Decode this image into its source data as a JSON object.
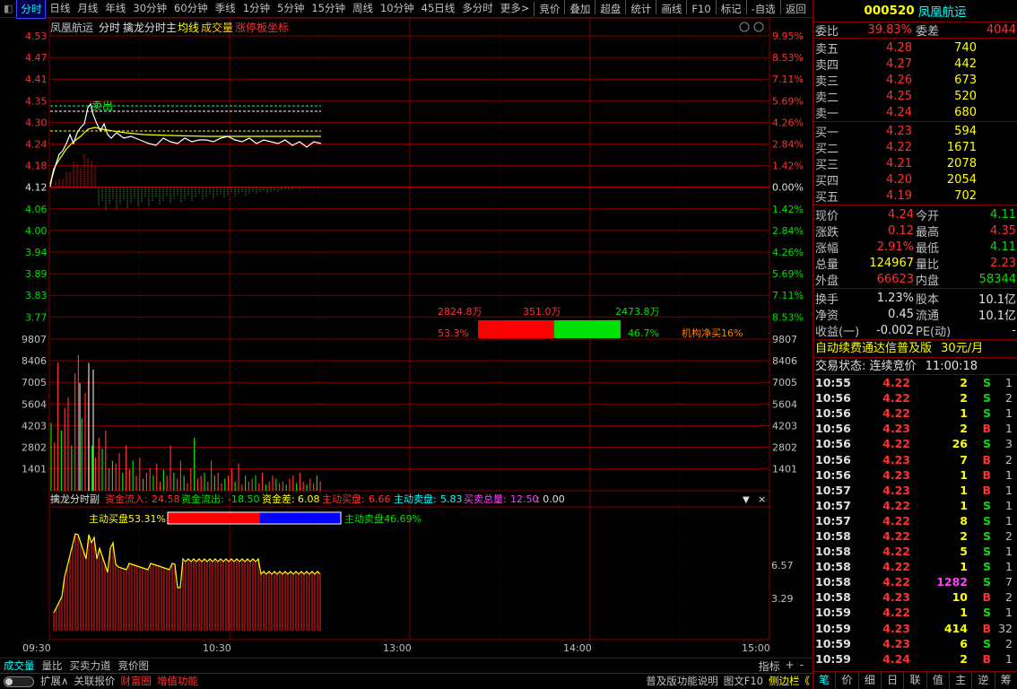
{
  "topbar": {
    "tabs": [
      "分时",
      "日线",
      "月线",
      "年线",
      "30分钟",
      "60分钟",
      "季线",
      "1分钟",
      "5分钟",
      "15分钟",
      "周线",
      "10分钟",
      "45日线",
      "多分时",
      "更多>"
    ],
    "active_index": 0,
    "right_tabs": [
      "竞价",
      "叠加",
      "超盘",
      "统计",
      "画线",
      "F10",
      "标记",
      "-自选",
      "返回"
    ]
  },
  "chart_header": {
    "stock_name": "凤凰航运",
    "mode": "分时",
    "indicator": "擒龙分时主",
    "avg_label": "均线",
    "vol_label": "成交量",
    "limit_label": "涨停板坐标"
  },
  "price_axis": {
    "left": [
      "4.53",
      "4.47",
      "4.41",
      "4.35",
      "4.30",
      "4.24",
      "4.18",
      "4.12",
      "4.06",
      "4.00",
      "3.94",
      "3.89",
      "3.83",
      "3.77"
    ],
    "right": [
      "9.95%",
      "8.53%",
      "7.11%",
      "5.69%",
      "4.26%",
      "2.84%",
      "1.42%",
      "0.00%",
      "1.42%",
      "2.84%",
      "4.26%",
      "5.69%",
      "7.11%",
      "8.53%"
    ]
  },
  "vol_axis": {
    "left": [
      "9807",
      "8406",
      "7005",
      "5604",
      "4203",
      "2802",
      "1401"
    ],
    "right": [
      "9807",
      "8406",
      "7005",
      "5604",
      "4203",
      "2802",
      "1401"
    ]
  },
  "time_axis": [
    "09:30",
    "10:30",
    "13:00",
    "14:00",
    "15:00"
  ],
  "annotation": {
    "label": "卖出"
  },
  "inst_panel": {
    "buy_amount": "2824.8万",
    "diff_amount": "351.0万",
    "sell_amount": "2473.8万",
    "buy_pct": "53.3%",
    "sell_pct": "46.7%",
    "net_label": "机构净买16%",
    "buy_share": 0.533
  },
  "sub_header": {
    "name": "擒龙分时副",
    "inflow_label": "资金流入:",
    "inflow": "24.58",
    "outflow_label": "资金流出:",
    "outflow": "-18.50",
    "diff_label": "资金差:",
    "diff": "6.08",
    "active_buy_label": "主动买盘:",
    "active_buy": "6.66",
    "active_sell_label": "主动卖盘:",
    "active_sell": "5.83",
    "total_label": "买卖总量:",
    "total": "12.50",
    "zero": ": 0.00",
    "buy_ratio_label": "主动买盘53.31%",
    "sell_ratio_label": "主动卖盘46.69%",
    "buy_ratio": 0.5331
  },
  "sub_axis": [
    "6.57",
    "3.29"
  ],
  "bottom_tabs": [
    "成交量",
    "量比",
    "买卖力道",
    "竞价图"
  ],
  "bottom_right": [
    "指标",
    "+",
    "-"
  ],
  "bottom_bar": {
    "expand": "扩展∧",
    "items": [
      "关联报价",
      "财富圈",
      "增值功能"
    ],
    "right": [
      "普及版功能说明",
      "图文F10",
      "侧边栏《"
    ]
  },
  "side": {
    "code": "000520",
    "name": "凤凰航运",
    "wei_bi_label": "委比",
    "wei_bi": "39.83%",
    "wei_cha_label": "委差",
    "wei_cha": "4044",
    "asks": [
      {
        "label": "卖五",
        "price": "4.28",
        "vol": "740"
      },
      {
        "label": "卖四",
        "price": "4.27",
        "vol": "442"
      },
      {
        "label": "卖三",
        "price": "4.26",
        "vol": "673"
      },
      {
        "label": "卖二",
        "price": "4.25",
        "vol": "520"
      },
      {
        "label": "卖一",
        "price": "4.24",
        "vol": "680"
      }
    ],
    "bids": [
      {
        "label": "买一",
        "price": "4.23",
        "vol": "594"
      },
      {
        "label": "买二",
        "price": "4.22",
        "vol": "1671"
      },
      {
        "label": "买三",
        "price": "4.21",
        "vol": "2078"
      },
      {
        "label": "买四",
        "price": "4.20",
        "vol": "2054"
      },
      {
        "label": "买五",
        "price": "4.19",
        "vol": "702"
      }
    ],
    "quote1": [
      {
        "k": "现价",
        "v": "4.24",
        "vc": "red",
        "k2": "今开",
        "v2": "4.11",
        "v2c": "green"
      },
      {
        "k": "涨跌",
        "v": "0.12",
        "vc": "red",
        "k2": "最高",
        "v2": "4.35",
        "v2c": "red"
      },
      {
        "k": "涨幅",
        "v": "2.91%",
        "vc": "red",
        "k2": "最低",
        "v2": "4.11",
        "v2c": "green"
      },
      {
        "k": "总量",
        "v": "124967",
        "vc": "yellow",
        "k2": "量比",
        "v2": "2.23",
        "v2c": "red"
      },
      {
        "k": "外盘",
        "v": "66623",
        "vc": "red",
        "k2": "内盘",
        "v2": "58344",
        "v2c": "green"
      }
    ],
    "quote2": [
      {
        "k": "换手",
        "v": "1.23%",
        "vc": "white",
        "k2": "股本",
        "v2": "10.1亿",
        "v2c": "white"
      },
      {
        "k": "净资",
        "v": "0.45",
        "vc": "white",
        "k2": "流通",
        "v2": "10.1亿",
        "v2c": "white"
      },
      {
        "k": "收益(一)",
        "v": "-0.002",
        "vc": "white",
        "k2": "PE(动)",
        "v2": "-",
        "v2c": "white"
      }
    ],
    "promo": "自动续费通达信普及版",
    "promo_price": "30元/月",
    "status_label": "交易状态:",
    "status": "连续竞价",
    "status_time": "11:00:18",
    "ticks": [
      {
        "t": "10:55",
        "p": "4.22",
        "q": "2",
        "d": "S",
        "n": "1"
      },
      {
        "t": "10:56",
        "p": "4.22",
        "q": "2",
        "d": "S",
        "n": "2"
      },
      {
        "t": "10:56",
        "p": "4.22",
        "q": "1",
        "d": "S",
        "n": "1"
      },
      {
        "t": "10:56",
        "p": "4.23",
        "q": "2",
        "d": "B",
        "n": "1"
      },
      {
        "t": "10:56",
        "p": "4.22",
        "q": "26",
        "d": "S",
        "n": "3"
      },
      {
        "t": "10:56",
        "p": "4.23",
        "q": "7",
        "d": "B",
        "n": "2"
      },
      {
        "t": "10:56",
        "p": "4.23",
        "q": "1",
        "d": "B",
        "n": "1"
      },
      {
        "t": "10:57",
        "p": "4.23",
        "q": "1",
        "d": "B",
        "n": "1"
      },
      {
        "t": "10:57",
        "p": "4.22",
        "q": "1",
        "d": "S",
        "n": "1"
      },
      {
        "t": "10:57",
        "p": "4.22",
        "q": "8",
        "d": "S",
        "n": "1"
      },
      {
        "t": "10:58",
        "p": "4.22",
        "q": "2",
        "d": "S",
        "n": "2"
      },
      {
        "t": "10:58",
        "p": "4.22",
        "q": "5",
        "d": "S",
        "n": "1"
      },
      {
        "t": "10:58",
        "p": "4.22",
        "q": "1",
        "d": "S",
        "n": "1"
      },
      {
        "t": "10:58",
        "p": "4.22",
        "q": "1282",
        "d": "S",
        "n": "7",
        "big": true
      },
      {
        "t": "10:58",
        "p": "4.23",
        "q": "10",
        "d": "B",
        "n": "2"
      },
      {
        "t": "10:59",
        "p": "4.22",
        "q": "1",
        "d": "S",
        "n": "1"
      },
      {
        "t": "10:59",
        "p": "4.23",
        "q": "414",
        "d": "B",
        "n": "32"
      },
      {
        "t": "10:59",
        "p": "4.23",
        "q": "6",
        "d": "S",
        "n": "2"
      },
      {
        "t": "10:59",
        "p": "4.24",
        "q": "2",
        "d": "B",
        "n": "1"
      }
    ],
    "bottom_tabs": [
      "笔",
      "价",
      "细",
      "日",
      "联",
      "值",
      "主",
      "逆",
      "筹"
    ]
  },
  "colors": {
    "up": "#ff3030",
    "down": "#00e000",
    "accent": "#00ffff",
    "grid": "#800000",
    "bg": "#000000"
  }
}
